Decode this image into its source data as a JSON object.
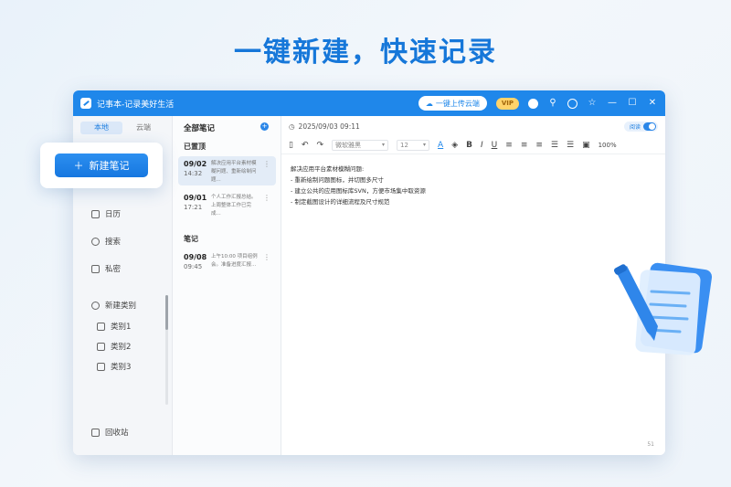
{
  "headline": "一键新建，快速记录",
  "window": {
    "title": "记事本-记录美好生活",
    "upload_label": "一键上传云端",
    "vip_label": "VIP"
  },
  "sidebar": {
    "tabs": [
      "本地",
      "云端"
    ],
    "new_note_label": "新建笔记",
    "items": [
      "日历",
      "搜索",
      "私密"
    ],
    "new_category_label": "新建类别",
    "categories": [
      "类别1",
      "类别2",
      "类别3"
    ],
    "trash_label": "回收站"
  },
  "notelist": {
    "title": "全部笔记",
    "pinned_label": "已置顶",
    "notes_label": "笔记",
    "pinned": [
      {
        "date": "09/02",
        "time": "14:32",
        "preview": "解决应用平台素材模糊问题、重新绘制问题..."
      },
      {
        "date": "09/01",
        "time": "17:21",
        "preview": "个人工作汇报总结。上周整体工作已完成..."
      }
    ],
    "notes": [
      {
        "date": "09/08",
        "time": "09:45",
        "preview": "上午10:00 项目组例会。准备进度汇报..."
      }
    ]
  },
  "editor": {
    "datetime": "2025/09/03 09:11",
    "read_mode_label": "阅读",
    "font_family": "微软雅黑",
    "font_size": "12",
    "zoom": "100%",
    "content": [
      "解决应用平台素材模糊问题:",
      "- 重新绘制问题图标，并切图多尺寸",
      "- 建立公共的应用图标库SVN，方便市场集中取资源",
      "- 制定截图设计的详细流程及尺寸规范"
    ],
    "word_count": "51"
  },
  "colors": {
    "accent": "#1f87ea",
    "headline": "#1677d9"
  }
}
